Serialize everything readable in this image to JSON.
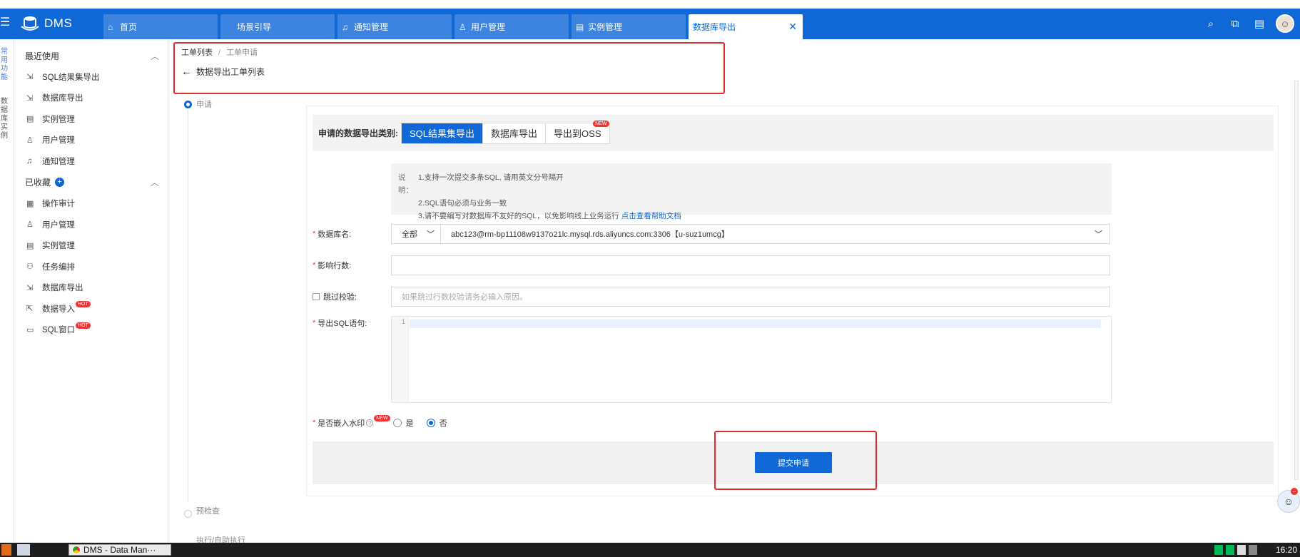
{
  "app": {
    "title": "DMS"
  },
  "tabs": [
    {
      "label": "首页",
      "icon": "home-icon"
    },
    {
      "label": "场景引导",
      "icon": ""
    },
    {
      "label": "通知管理",
      "icon": "bell-icon"
    },
    {
      "label": "用户管理",
      "icon": "user-icon"
    },
    {
      "label": "实例管理",
      "icon": "database-icon"
    },
    {
      "label": "数据库导出",
      "icon": "",
      "active": true
    }
  ],
  "rail": {
    "line1": "常用功能",
    "line2": "数据库实例"
  },
  "sidebar": {
    "recent_label": "最近使用",
    "recent": [
      {
        "label": "SQL结果集导出",
        "icon": "export-icon"
      },
      {
        "label": "数据库导出",
        "icon": "export-icon"
      },
      {
        "label": "实例管理",
        "icon": "database-icon"
      },
      {
        "label": "用户管理",
        "icon": "user-icon"
      },
      {
        "label": "通知管理",
        "icon": "bell-icon"
      }
    ],
    "fav_label": "已收藏",
    "favorites": [
      {
        "label": "操作审计",
        "icon": "audit-icon"
      },
      {
        "label": "用户管理",
        "icon": "user-icon"
      },
      {
        "label": "实例管理",
        "icon": "database-icon"
      },
      {
        "label": "任务编排",
        "icon": "flow-icon"
      },
      {
        "label": "数据库导出",
        "icon": "export-icon"
      },
      {
        "label": "数据导入",
        "icon": "import-icon",
        "badge": "HOT"
      },
      {
        "label": "SQL窗口",
        "icon": "window-icon",
        "badge": "HOT"
      }
    ]
  },
  "breadcrumb": {
    "parent": "工单列表",
    "separator": "/",
    "current": "工单申请"
  },
  "page_title": "数据导出工单列表",
  "steps": [
    {
      "label": "申请",
      "active": true
    },
    {
      "label": "预检查"
    },
    {
      "label": "执行/自助执行"
    }
  ],
  "form": {
    "type_label": "申请的数据导出类别:",
    "types": [
      {
        "label": "SQL结果集导出",
        "active": true
      },
      {
        "label": "数据库导出"
      },
      {
        "label": "导出到OSS",
        "badge": "NEW"
      }
    ],
    "note": {
      "prefix": "说明：",
      "lines": [
        "1.支持一次提交多条SQL, 请用英文分号隔开",
        "2.SQL语句必须与业务一致",
        "3.请不要编写对数据库不友好的SQL，以免影响线上业务运行"
      ],
      "link": "点击查看帮助文档"
    },
    "db_label": "数据库名:",
    "db_scope": "全部",
    "db_value": "abc123@rm-bp11108w9137o21lc.mysql.rds.aliyuncs.com:3306【u-suz1umcg】",
    "rows_label": "影响行数:",
    "rows_value": "",
    "skip_label": "跳过校验:",
    "skip_placeholder": "如果跳过行数校验请务必输入原因。",
    "sql_label": "导出SQL语句:",
    "sql_line_no": "1",
    "watermark_label": "是否嵌入水印",
    "watermark_badge": "NEW",
    "watermark_yes": "是",
    "watermark_no": "否",
    "submit_label": "提交申请"
  },
  "taskbar": {
    "window_title": "DMS - Data Man···",
    "clock": "16:20"
  },
  "colors": {
    "brand": "#1068d6",
    "highlight": "#e12b2b",
    "badge": "#ee3333"
  }
}
